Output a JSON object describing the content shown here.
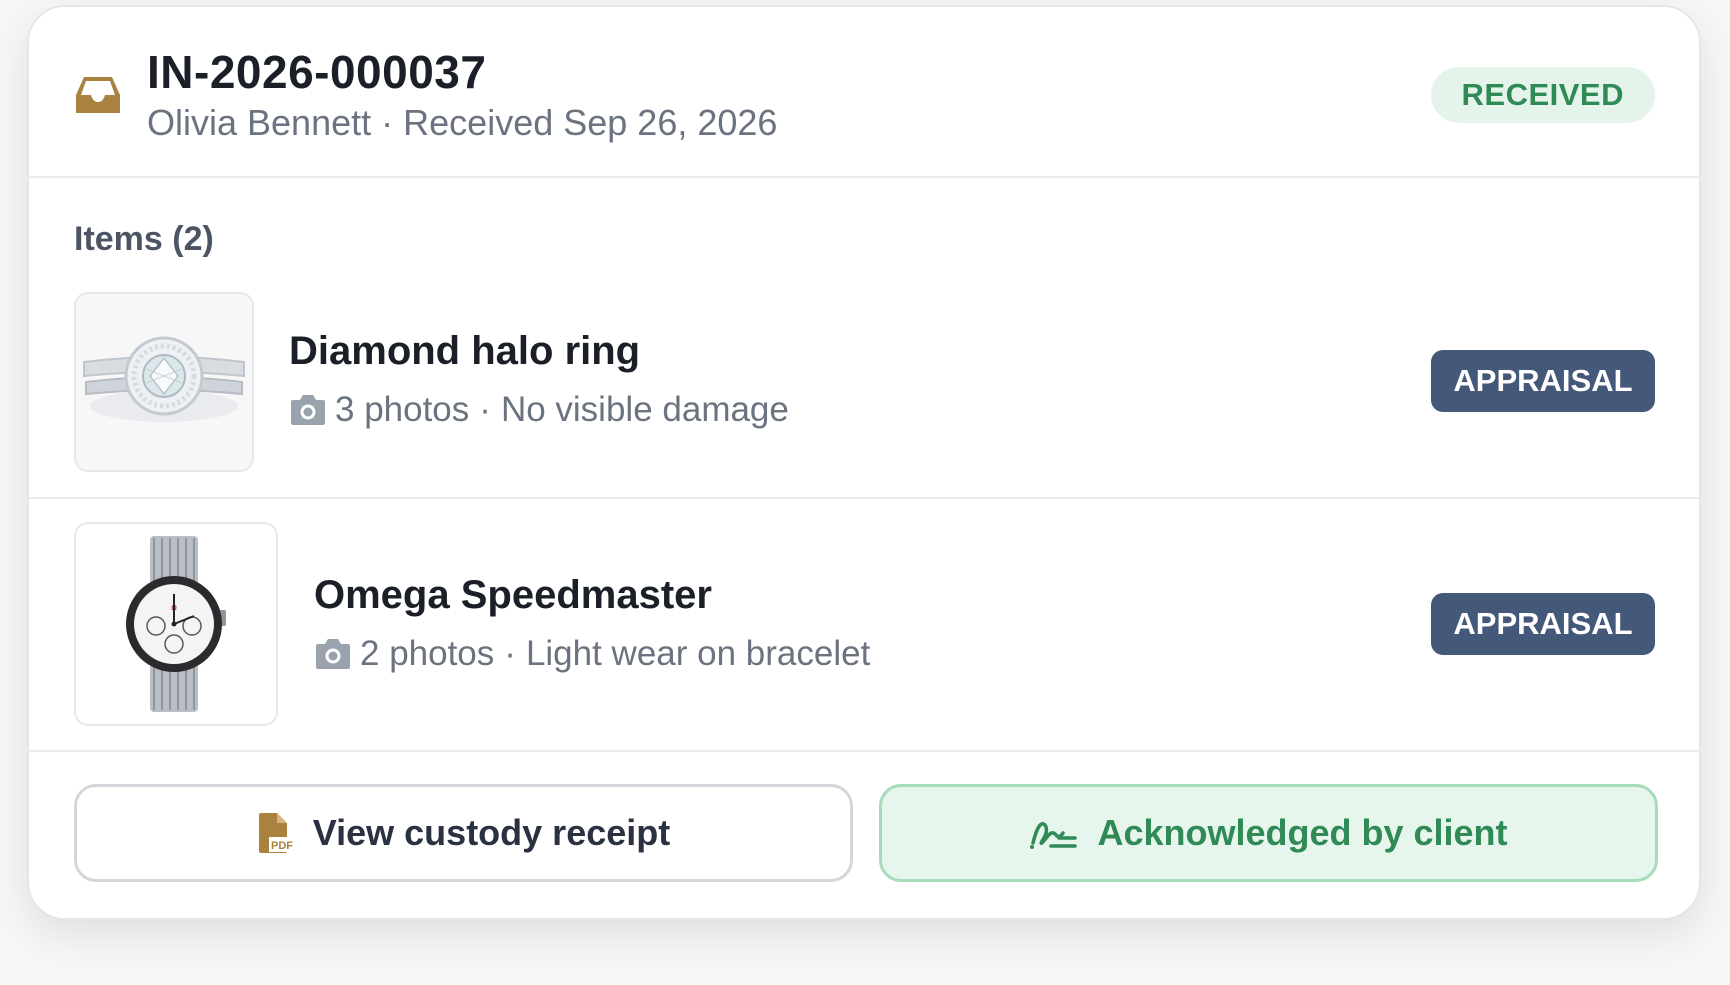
{
  "header": {
    "intake_id": "IN-2026-000037",
    "client_name": "Olivia Bennett",
    "separator": "·",
    "received_text": "Received Sep 26, 2026",
    "status": "RECEIVED",
    "icon": "inbox-icon"
  },
  "items_heading": "Items (2)",
  "items": [
    {
      "name": "Diamond halo ring",
      "photos": "3 photos",
      "condition": "No visible damage",
      "service": "APPRAISAL",
      "thumbnail": "ring-image"
    },
    {
      "name": "Omega Speedmaster",
      "photos": "2 photos",
      "condition": "Light wear on bracelet",
      "service": "APPRAISAL",
      "thumbnail": "watch-image"
    }
  ],
  "actions": {
    "receipt_label": "View custody receipt",
    "receipt_icon": "pdf-file-icon",
    "ack_label": "Acknowledged by client",
    "ack_icon": "signature-icon"
  },
  "colors": {
    "accent_gold": "#a9823f",
    "status_green": "#2f8a56",
    "status_green_bg": "#e4f4ea",
    "badge_navy": "#44587a"
  }
}
